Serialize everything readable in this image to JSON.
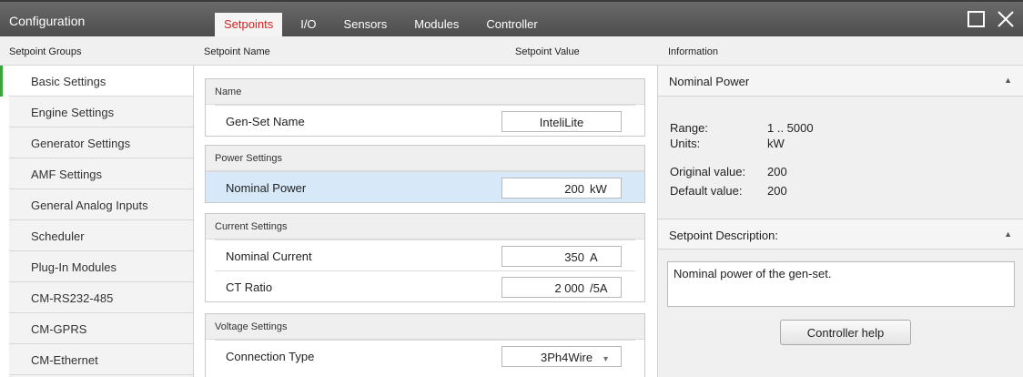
{
  "app": {
    "title": "Configuration"
  },
  "tabs": [
    {
      "label": "Setpoints",
      "active": true
    },
    {
      "label": "I/O"
    },
    {
      "label": "Sensors"
    },
    {
      "label": "Modules"
    },
    {
      "label": "Controller"
    }
  ],
  "window": {
    "maximize_icon": "maximize-icon",
    "close_icon": "close-icon"
  },
  "columns": {
    "groups": "Setpoint Groups",
    "name": "Setpoint Name",
    "value": "Setpoint Value",
    "info": "Information"
  },
  "sidebar": {
    "items": [
      {
        "label": "Basic Settings",
        "active": true
      },
      {
        "label": "Engine Settings"
      },
      {
        "label": "Generator Settings"
      },
      {
        "label": "AMF Settings"
      },
      {
        "label": "General Analog Inputs"
      },
      {
        "label": "Scheduler"
      },
      {
        "label": "Plug-In Modules"
      },
      {
        "label": "CM-RS232-485"
      },
      {
        "label": "CM-GPRS"
      },
      {
        "label": "CM-Ethernet"
      }
    ]
  },
  "setpoints": {
    "name_group": {
      "title": "Name",
      "rows": [
        {
          "name": "Gen-Set Name",
          "value": "InteliLite"
        }
      ]
    },
    "power_group": {
      "title": "Power Settings",
      "rows": [
        {
          "name": "Nominal Power",
          "value": "200",
          "unit": "kW",
          "selected": true
        }
      ]
    },
    "current_group": {
      "title": "Current Settings",
      "rows": [
        {
          "name": "Nominal Current",
          "value": "350",
          "unit": "A"
        },
        {
          "name": "CT Ratio",
          "value": "2 000",
          "unit": "/5A"
        }
      ]
    },
    "voltage_group": {
      "title": "Voltage Settings",
      "rows": [
        {
          "name": "Connection Type",
          "value": "3Ph4Wire",
          "dropdown_icon": "chevron-down-icon"
        }
      ]
    }
  },
  "info": {
    "title": "Nominal Power",
    "range_label": "Range:",
    "range_value": "1 .. 5000",
    "units_label": "Units:",
    "units_value": "kW",
    "original_label": "Original value:",
    "original_value": "200",
    "default_label": "Default value:",
    "default_value": "200",
    "desc_title": "Setpoint Description:",
    "description": "Nominal power of the gen-set.",
    "help_button": "Controller help",
    "collapse_icon": "collapse-up-icon"
  },
  "colors": {
    "titlebar": "#555555",
    "active_tab_text": "#e0201e",
    "selection": "#d7e9f8",
    "active_marker": "#3aa53a"
  }
}
